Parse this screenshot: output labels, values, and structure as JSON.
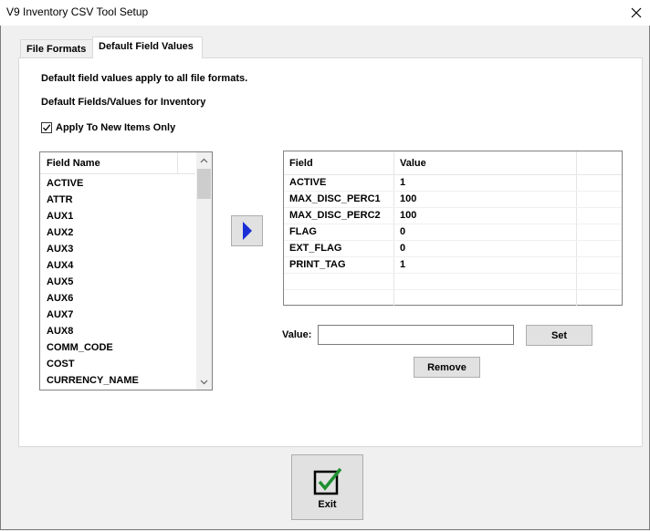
{
  "window": {
    "title": "V9 Inventory CSV Tool Setup",
    "close_glyph": "✕"
  },
  "tabs": [
    {
      "label": "File Formats",
      "active": false
    },
    {
      "label": "Default Field Values",
      "active": true
    }
  ],
  "panel": {
    "info_text": "Default field values apply to all file formats.",
    "section_title": "Default Fields/Values for Inventory",
    "apply_new_only": {
      "label": "Apply To New Items Only",
      "checked": true
    }
  },
  "field_list": {
    "header": "Field Name",
    "items": [
      "ACTIVE",
      "ATTR",
      "AUX1",
      "AUX2",
      "AUX3",
      "AUX4",
      "AUX5",
      "AUX6",
      "AUX7",
      "AUX8",
      "COMM_CODE",
      "COST",
      "CURRENCY_NAME"
    ]
  },
  "values_grid": {
    "headers": {
      "field": "Field",
      "value": "Value"
    },
    "rows": [
      {
        "field": "ACTIVE",
        "value": "1"
      },
      {
        "field": "MAX_DISC_PERC1",
        "value": "100"
      },
      {
        "field": "MAX_DISC_PERC2",
        "value": "100"
      },
      {
        "field": "FLAG",
        "value": "0"
      },
      {
        "field": "EXT_FLAG",
        "value": "0"
      },
      {
        "field": "PRINT_TAG",
        "value": "1"
      }
    ]
  },
  "value_editor": {
    "label": "Value:",
    "current_value": "",
    "set_label": "Set",
    "remove_label": "Remove"
  },
  "exit": {
    "label": "Exit"
  },
  "colors": {
    "move_arrow": "#1a2fd6",
    "exit_check": "#1f8f2f"
  }
}
